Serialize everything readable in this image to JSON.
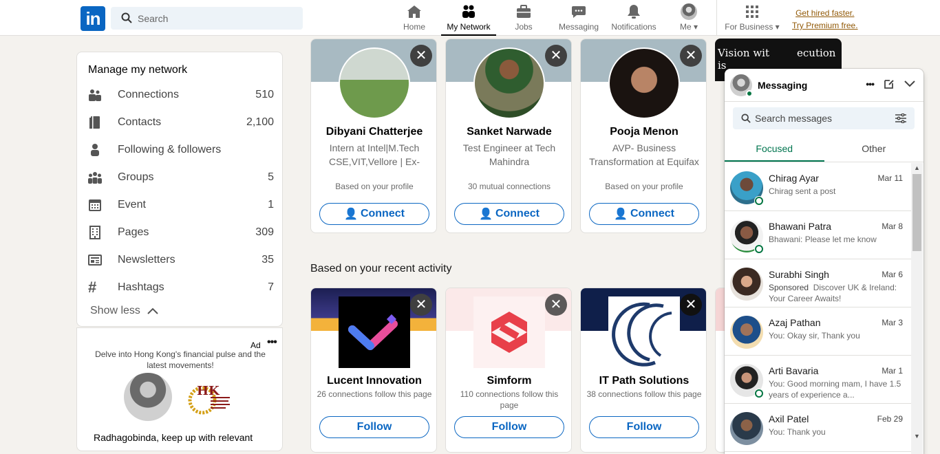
{
  "header": {
    "logo": "in",
    "search_placeholder": "Search",
    "nav": [
      {
        "label": "Home",
        "icon": "home-icon"
      },
      {
        "label": "My Network",
        "icon": "network-icon"
      },
      {
        "label": "Jobs",
        "icon": "briefcase-icon"
      },
      {
        "label": "Messaging",
        "icon": "chat-icon"
      },
      {
        "label": "Notifications",
        "icon": "bell-icon"
      },
      {
        "label": "Me",
        "icon": "avatar"
      },
      {
        "label": "For Business",
        "icon": "grid-icon"
      }
    ],
    "premium_line1": "Get hired faster.",
    "premium_line2": "Try Premium free."
  },
  "sidebar": {
    "title": "Manage my network",
    "items": [
      {
        "label": "Connections",
        "count": "510",
        "icon": "people-icon"
      },
      {
        "label": "Contacts",
        "count": "2,100",
        "icon": "contacts-book-icon"
      },
      {
        "label": "Following & followers",
        "count": "",
        "icon": "person-icon"
      },
      {
        "label": "Groups",
        "count": "5",
        "icon": "group-icon"
      },
      {
        "label": "Event",
        "count": "1",
        "icon": "calendar-icon"
      },
      {
        "label": "Pages",
        "count": "309",
        "icon": "building-icon"
      },
      {
        "label": "Newsletters",
        "count": "35",
        "icon": "newspaper-icon"
      },
      {
        "label": "Hashtags",
        "count": "7",
        "icon": "hashtag-icon"
      }
    ],
    "show_less": "Show less"
  },
  "ad": {
    "label": "Ad",
    "text": "Delve into Hong Kong's financial pulse and the latest movements!",
    "bottom": "Radhagobinda, keep up with relevant"
  },
  "people": [
    {
      "name": "Dibyani Chatterjee",
      "desc": "Intern at Intel|M.Tech CSE,VIT,Vellore | Ex-TCSer",
      "mutual": "Based on your profile",
      "button": "Connect"
    },
    {
      "name": "Sanket Narwade",
      "desc": "Test Engineer at Tech Mahindra",
      "mutual": "30 mutual connections",
      "button": "Connect"
    },
    {
      "name": "Pooja Menon",
      "desc": "AVP- Business Transformation at Equifax",
      "mutual": "Based on your profile",
      "button": "Connect"
    }
  ],
  "partial_card_text": "Vision wit",
  "partial_card_text2": "ecution is",
  "recent_title": "Based on your recent activity",
  "companies": [
    {
      "name": "Lucent Innovation",
      "followers": "26 connections follow this page",
      "button": "Follow"
    },
    {
      "name": "Simform",
      "followers": "110 connections follow this page",
      "button": "Follow"
    },
    {
      "name": "IT Path Solutions",
      "followers": "38 connections follow this page",
      "button": "Follow"
    }
  ],
  "messaging": {
    "title": "Messaging",
    "search_placeholder": "Search messages",
    "tabs": [
      "Focused",
      "Other"
    ],
    "conversations": [
      {
        "name": "Chirag Ayar",
        "date": "Mar 11",
        "preview": "Chirag sent a post",
        "sponsored": "",
        "online": true
      },
      {
        "name": "Bhawani Patra",
        "date": "Mar 8",
        "preview": "Bhawani: Please let me know",
        "sponsored": "",
        "online": true
      },
      {
        "name": "Surabhi Singh",
        "date": "Mar 6",
        "preview": "Discover UK & Ireland: Your Career Awaits!",
        "sponsored": "Sponsored",
        "online": false
      },
      {
        "name": "Azaj Pathan",
        "date": "Mar 3",
        "preview": "You: Okay sir, Thank you",
        "sponsored": "",
        "online": false
      },
      {
        "name": "Arti Bavaria",
        "date": "Mar 1",
        "preview": "You: Good morning mam, I have 1.5 years of experience a...",
        "sponsored": "",
        "online": true
      },
      {
        "name": "Axil Patel",
        "date": "Feb 29",
        "preview": "You: Thank you",
        "sponsored": "",
        "online": false
      }
    ]
  }
}
